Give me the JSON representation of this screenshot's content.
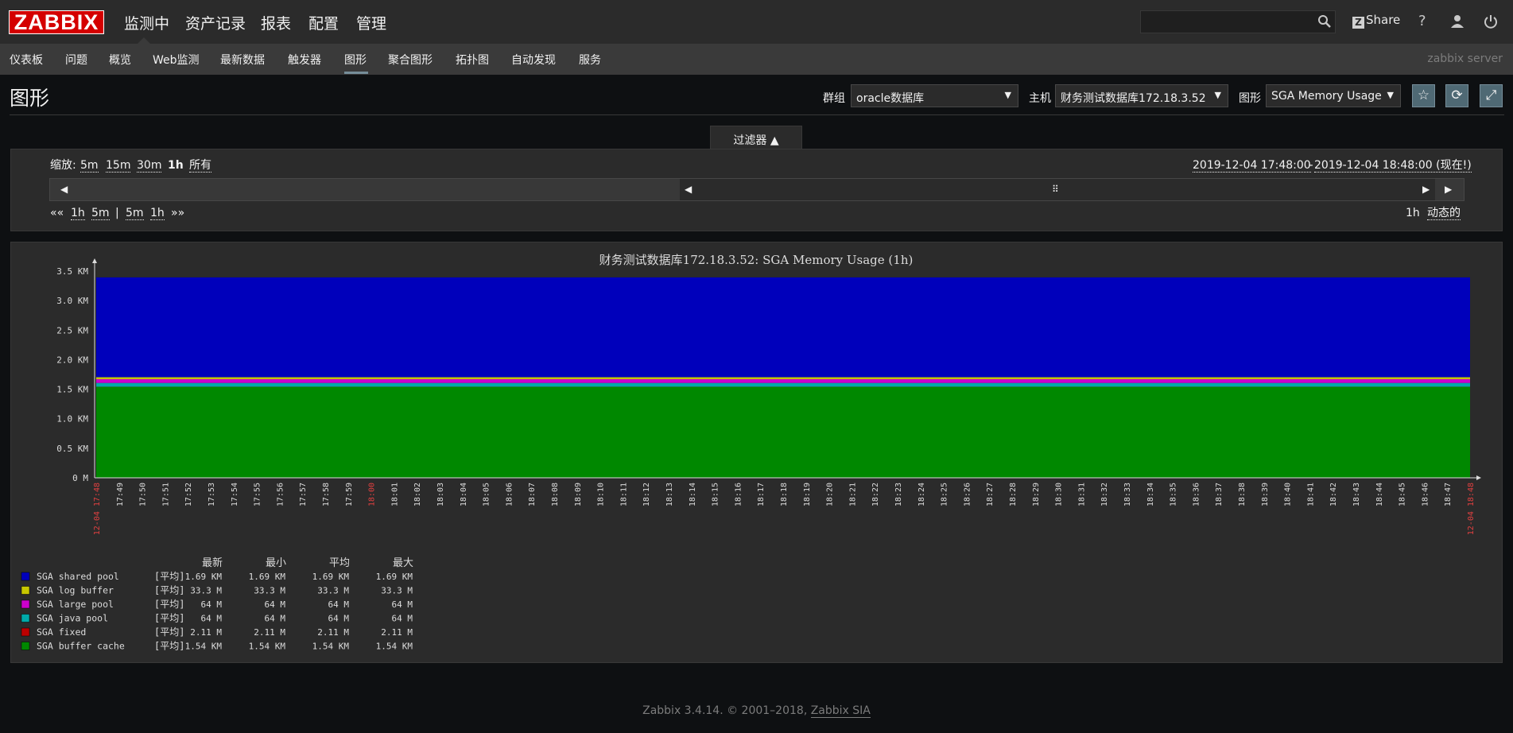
{
  "header": {
    "logo": "ZABBIX",
    "main_menu": [
      "监测中",
      "资产记录",
      "报表",
      "配置",
      "管理"
    ],
    "share": "Share",
    "help": "?",
    "server_name": "zabbix server"
  },
  "sub_menu": [
    "仪表板",
    "问题",
    "概览",
    "Web监测",
    "最新数据",
    "触发器",
    "图形",
    "聚合图形",
    "拓扑图",
    "自动发现",
    "服务"
  ],
  "page": {
    "title": "图形",
    "group_label": "群组",
    "group_value": "oracle数据库",
    "host_label": "主机",
    "host_value": "财务测试数据库172.18.3.52",
    "graph_label": "图形",
    "graph_value": "SGA Memory Usage"
  },
  "filter": {
    "tab_label": "过滤器 ▲",
    "zoom_label": "缩放:",
    "zoom_options": [
      "5m",
      "15m",
      "30m",
      "1h",
      "所有"
    ],
    "time_from": "2019-12-04 17:48:00",
    "time_sep": " - ",
    "time_to": "2019-12-04 18:48:00 (现在!)",
    "back_all": "««",
    "nav_left": [
      "1h",
      "5m"
    ],
    "nav_sep": "|",
    "nav_right": [
      "5m",
      "1h"
    ],
    "fwd_all": "»»",
    "period": "1h",
    "dynamic": "动态的"
  },
  "chart_data": {
    "type": "area",
    "title": "财务测试数据库172.18.3.52: SGA Memory Usage (1h)",
    "y_ticks": [
      "3.5 KM",
      "3.0 KM",
      "2.5 KM",
      "2.0 KM",
      "1.5 KM",
      "1.0 KM",
      "0.5 KM",
      "0 M"
    ],
    "ylim_km": [
      0,
      3.5
    ],
    "x_ticks": [
      "17:49",
      "17:50",
      "17:51",
      "17:52",
      "17:53",
      "17:54",
      "17:55",
      "17:56",
      "17:57",
      "17:58",
      "17:59",
      "18:00",
      "18:01",
      "18:02",
      "18:03",
      "18:04",
      "18:05",
      "18:06",
      "18:07",
      "18:08",
      "18:09",
      "18:10",
      "18:11",
      "18:12",
      "18:13",
      "18:14",
      "18:15",
      "18:16",
      "18:17",
      "18:18",
      "18:19",
      "18:20",
      "18:21",
      "18:22",
      "18:23",
      "18:24",
      "18:25",
      "18:26",
      "18:27",
      "18:28",
      "18:29",
      "18:30",
      "18:31",
      "18:32",
      "18:33",
      "18:34",
      "18:35",
      "18:36",
      "18:37",
      "18:38",
      "18:39",
      "18:40",
      "18:41",
      "18:42",
      "18:43",
      "18:44",
      "18:45",
      "18:46",
      "18:47"
    ],
    "x_start": "12-04 17:48",
    "x_end": "12-04 18:48",
    "legend_headers": [
      "最新",
      "最小",
      "平均",
      "最大"
    ],
    "series": [
      {
        "name": "SGA shared pool",
        "func": "[平均]",
        "color": "#0000bb",
        "value_km": 1.69,
        "last": "1.69 KM",
        "min": "1.69 KM",
        "avg": "1.69 KM",
        "max": "1.69 KM"
      },
      {
        "name": "SGA log buffer",
        "func": "[平均]",
        "color": "#c8c800",
        "value_km": 0.0333,
        "last": "33.3 M",
        "min": "33.3 M",
        "avg": "33.3 M",
        "max": "33.3 M"
      },
      {
        "name": "SGA large pool",
        "func": "[平均]",
        "color": "#cc00cc",
        "value_km": 0.064,
        "last": "64 M",
        "min": "64 M",
        "avg": "64 M",
        "max": "64 M"
      },
      {
        "name": "SGA java pool",
        "func": "[平均]",
        "color": "#00aaaa",
        "value_km": 0.064,
        "last": "64 M",
        "min": "64 M",
        "avg": "64 M",
        "max": "64 M"
      },
      {
        "name": "SGA fixed",
        "func": "[平均]",
        "color": "#bb0000",
        "value_km": 0.00211,
        "last": "2.11 M",
        "min": "2.11 M",
        "avg": "2.11 M",
        "max": "2.11 M"
      },
      {
        "name": "SGA buffer cache",
        "func": "[平均]",
        "color": "#008800",
        "value_km": 1.54,
        "last": "1.54 KM",
        "min": "1.54 KM",
        "avg": "1.54 KM",
        "max": "1.54 KM"
      }
    ]
  },
  "footer": {
    "text": "Zabbix 3.4.14. © 2001–2018, ",
    "link": "Zabbix SIA"
  }
}
